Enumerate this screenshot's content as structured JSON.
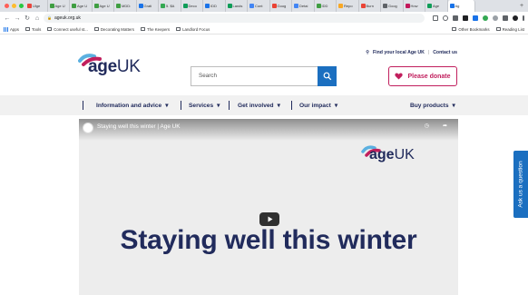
{
  "browser": {
    "tabs": [
      {
        "label": "Ulge",
        "color": "#e8453c",
        "active": false
      },
      {
        "label": "Age U",
        "color": "#3f9e42",
        "active": false
      },
      {
        "label": "Age U",
        "color": "#3f9e42",
        "active": false
      },
      {
        "label": "Age U",
        "color": "#3f9e42",
        "active": false
      },
      {
        "label": "MDD:",
        "color": "#3f9e42",
        "active": false
      },
      {
        "label": "Grati",
        "color": "#1a73e8",
        "active": false
      },
      {
        "label": "5. $A",
        "color": "#34a853",
        "active": false
      },
      {
        "label": "Deco",
        "color": "#0f9d58",
        "active": false
      },
      {
        "label": "IDD",
        "color": "#1a73e8",
        "active": false
      },
      {
        "label": "Lands",
        "color": "#0f9d58",
        "active": false
      },
      {
        "label": "Cont",
        "color": "#4285f4",
        "active": false
      },
      {
        "label": "Goog",
        "color": "#ea4335",
        "active": false
      },
      {
        "label": "Detai",
        "color": "#4285f4",
        "active": false
      },
      {
        "label": "IDD",
        "color": "#3f9e42",
        "active": false
      },
      {
        "label": "Repo",
        "color": "#f9a825",
        "active": false
      },
      {
        "label": "Burn",
        "color": "#ea4335",
        "active": false
      },
      {
        "label": "Goog",
        "color": "#5f6368",
        "active": false
      },
      {
        "label": "How",
        "color": "#c2185b",
        "active": false
      },
      {
        "label": "Age",
        "color": "#0f9d58",
        "active": false
      },
      {
        "label": "Ag",
        "color": "#1a73e8",
        "active": true
      }
    ],
    "new_tab": "+",
    "url": "ageuk.org.uk",
    "bookmarks": [
      {
        "label": "Apps",
        "folder": false
      },
      {
        "label": "Tools",
        "folder": true
      },
      {
        "label": "Connect useful st...",
        "folder": true
      },
      {
        "label": "Decorating Matters",
        "folder": true
      },
      {
        "label": "The Keepers",
        "folder": true
      },
      {
        "label": "Landlord Focus",
        "folder": true
      }
    ],
    "bookmarks_right": [
      "Other Bookmarks",
      "Reading List"
    ]
  },
  "header": {
    "find_local": "Find your local Age UK",
    "contact": "Contact us",
    "logo_age": "age",
    "logo_uk": "UK",
    "search_placeholder": "Search",
    "donate_label": "Please donate"
  },
  "nav": {
    "items": [
      "Information and advice",
      "Services",
      "Get involved",
      "Our impact",
      "Buy products"
    ],
    "dropdown_glyph": "▾"
  },
  "video": {
    "title": "Staying well this winter | Age UK",
    "headline": "Staying well this winter",
    "logo_age": "age",
    "logo_uk": "UK"
  },
  "side_tab": {
    "label": "Ask us a question"
  },
  "colors": {
    "navy": "#212b5c",
    "pink": "#c11f5d",
    "blue": "#1b6fc0",
    "nav_bg": "#f1f1f1"
  }
}
